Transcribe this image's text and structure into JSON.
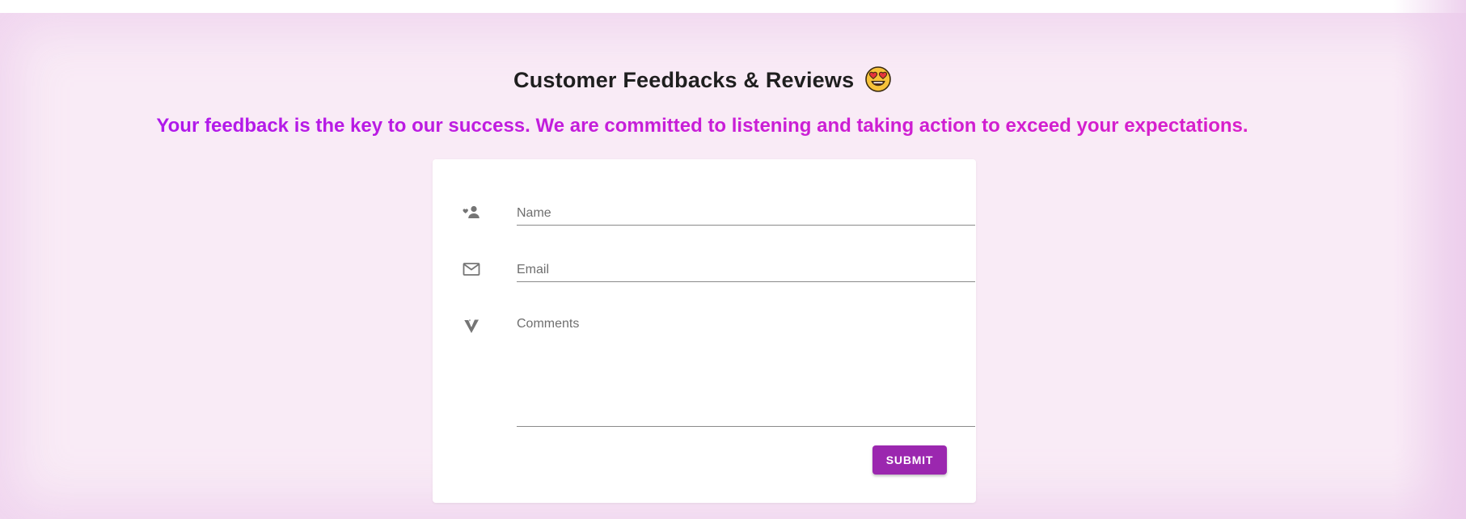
{
  "section": {
    "title": "Customer Feedbacks & Reviews",
    "title_emoji": "heart-eyes-emoji",
    "tagline": "Your feedback is the key to our success. We are committed to listening and taking action to exceed your expectations."
  },
  "form": {
    "name": {
      "placeholder": "Name",
      "icon": "user-heart-icon"
    },
    "email": {
      "placeholder": "Email",
      "icon": "mail-icon"
    },
    "comments": {
      "placeholder": "Comments",
      "icon": "vuetify-icon"
    },
    "submit_label": "SUBMIT"
  },
  "colors": {
    "accent": "#9b27af",
    "tagline_start": "#a716f2",
    "tagline_end": "#dd1fc6",
    "background": "#f9ebf6",
    "card": "#ffffff"
  }
}
